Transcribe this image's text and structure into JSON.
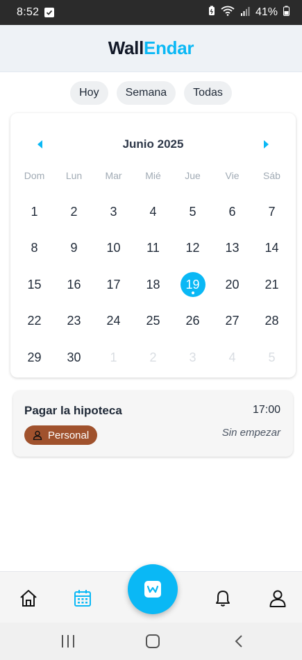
{
  "status_bar": {
    "time": "8:52",
    "battery_percent": "41%",
    "icons": [
      "check-icon",
      "battery-saver-icon",
      "wifi-icon",
      "signal-icon",
      "battery-icon"
    ]
  },
  "app": {
    "logo_part1": "Wall",
    "logo_part2": "Endar",
    "accent_color": "#0ab8f5"
  },
  "filters": [
    {
      "label": "Hoy"
    },
    {
      "label": "Semana"
    },
    {
      "label": "Todas"
    }
  ],
  "calendar": {
    "title": "Junio 2025",
    "weekdays": [
      "Dom",
      "Lun",
      "Mar",
      "Mié",
      "Jue",
      "Vie",
      "Sáb"
    ],
    "selected_day": "19",
    "days": [
      {
        "n": "1",
        "m": false
      },
      {
        "n": "2",
        "m": false
      },
      {
        "n": "3",
        "m": false
      },
      {
        "n": "4",
        "m": false
      },
      {
        "n": "5",
        "m": false
      },
      {
        "n": "6",
        "m": false
      },
      {
        "n": "7",
        "m": false
      },
      {
        "n": "8",
        "m": false
      },
      {
        "n": "9",
        "m": false
      },
      {
        "n": "10",
        "m": false
      },
      {
        "n": "11",
        "m": false
      },
      {
        "n": "12",
        "m": false
      },
      {
        "n": "13",
        "m": false
      },
      {
        "n": "14",
        "m": false
      },
      {
        "n": "15",
        "m": false
      },
      {
        "n": "16",
        "m": false
      },
      {
        "n": "17",
        "m": false
      },
      {
        "n": "18",
        "m": false
      },
      {
        "n": "19",
        "m": false
      },
      {
        "n": "20",
        "m": false
      },
      {
        "n": "21",
        "m": false
      },
      {
        "n": "22",
        "m": false
      },
      {
        "n": "23",
        "m": false
      },
      {
        "n": "24",
        "m": false
      },
      {
        "n": "25",
        "m": false
      },
      {
        "n": "26",
        "m": false
      },
      {
        "n": "27",
        "m": false
      },
      {
        "n": "28",
        "m": false
      },
      {
        "n": "29",
        "m": false
      },
      {
        "n": "30",
        "m": false
      },
      {
        "n": "1",
        "m": true
      },
      {
        "n": "2",
        "m": true
      },
      {
        "n": "3",
        "m": true
      },
      {
        "n": "4",
        "m": true
      },
      {
        "n": "5",
        "m": true
      }
    ]
  },
  "events": [
    {
      "title": "Pagar la hipoteca",
      "time": "17:00",
      "tag": "Personal",
      "tag_color": "#a0522d",
      "status": "Sin empezar"
    }
  ],
  "bottom_nav": {
    "items": [
      "home-icon",
      "calendar-icon",
      "bell-icon",
      "user-icon"
    ],
    "fab_icon": "w-logo-icon",
    "active": "calendar-icon"
  },
  "system_nav": [
    "recents-icon",
    "home-button-icon",
    "back-icon"
  ]
}
